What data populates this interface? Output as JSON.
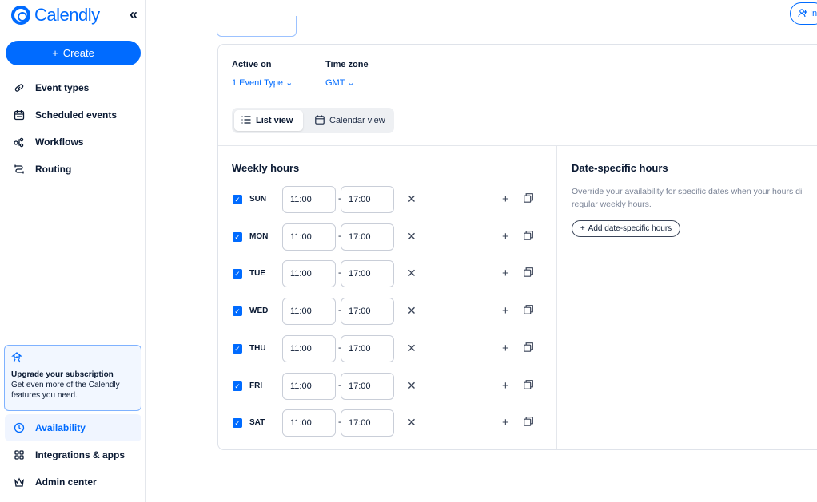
{
  "sidebar": {
    "logo_text": "Calendly",
    "collapse_icon": "«",
    "create_label": "Create",
    "nav": [
      {
        "label": "Event types",
        "icon": "link-icon"
      },
      {
        "label": "Scheduled events",
        "icon": "calendar-icon"
      },
      {
        "label": "Workflows",
        "icon": "workflow-icon"
      },
      {
        "label": "Routing",
        "icon": "routing-icon"
      }
    ],
    "upgrade": {
      "title": "Upgrade your subscription",
      "text": "Get even more of the Calendly features you need."
    },
    "bottom_nav": [
      {
        "label": "Availability",
        "icon": "clock-icon",
        "active": true
      },
      {
        "label": "Integrations & apps",
        "icon": "grid-icon"
      },
      {
        "label": "Admin center",
        "icon": "crown-icon"
      }
    ]
  },
  "header": {
    "invite_label": "In"
  },
  "settings": {
    "active_on_label": "Active on",
    "active_on_value": "1 Event Type",
    "timezone_label": "Time zone",
    "timezone_value": "GMT",
    "list_view_label": "List view",
    "calendar_view_label": "Calendar view"
  },
  "weekly": {
    "title": "Weekly hours",
    "days": [
      {
        "day": "SUN",
        "start": "11:00",
        "end": "17:00"
      },
      {
        "day": "MON",
        "start": "11:00",
        "end": "17:00"
      },
      {
        "day": "TUE",
        "start": "11:00",
        "end": "17:00"
      },
      {
        "day": "WED",
        "start": "11:00",
        "end": "17:00"
      },
      {
        "day": "THU",
        "start": "11:00",
        "end": "17:00"
      },
      {
        "day": "FRI",
        "start": "11:00",
        "end": "17:00"
      },
      {
        "day": "SAT",
        "start": "11:00",
        "end": "17:00"
      }
    ],
    "separator": "-"
  },
  "date_specific": {
    "title": "Date-specific hours",
    "desc_line1": "Override your availability for specific dates when your hours di",
    "desc_line2": "regular weekly hours.",
    "add_label": "Add date-specific hours"
  },
  "colors": {
    "accent": "#006bff",
    "text": "#0b1a33",
    "muted": "#7a8396"
  }
}
